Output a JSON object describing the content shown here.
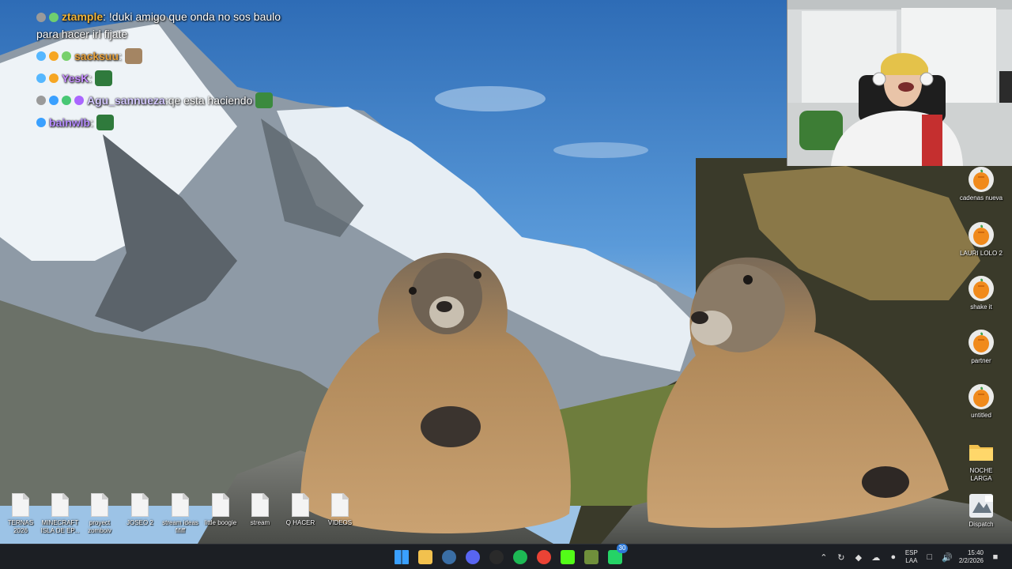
{
  "chat": {
    "messages": [
      {
        "username": "ztample",
        "username_color": "#f2b538",
        "separator": ":",
        "text": " !duki amigo que onda no sos baulo para hacer irl fijate",
        "badges": [
          "#9a9a9a",
          "#6fcf6f"
        ],
        "emotes": []
      },
      {
        "username": "sacksuu",
        "username_color": "#e8a13a",
        "separator": ":",
        "text": "",
        "badges": [
          "#55b7ff",
          "#f6a623",
          "#77d06c"
        ],
        "emotes": [
          "#a48563"
        ]
      },
      {
        "username": "YesK",
        "username_color": "#c58cff",
        "separator": ":",
        "text": "",
        "badges": [
          "#55b7ff",
          "#f6a623"
        ],
        "emotes": [
          "#2f7a3c"
        ]
      },
      {
        "username": "Agu_sannueza",
        "username_color": "#d4c8ff",
        "separator": ":",
        "text": " qe esta haciendo",
        "badges": [
          "#9a9a9a",
          "#3aa0ff",
          "#48c774",
          "#aa66ff"
        ],
        "emotes": [
          "#3b8a3e"
        ]
      },
      {
        "username": "bainwlb",
        "username_color": "#b58cff",
        "separator": ":",
        "text": "",
        "badges": [
          "#3aa0ff"
        ],
        "emotes": [
          "#2f7a3c"
        ]
      }
    ]
  },
  "desktop": {
    "right_icons": [
      {
        "label": "cadenas nueva",
        "icon": "fl-studio-icon"
      },
      {
        "label": "LAURI LOLO 2",
        "icon": "fl-studio-icon"
      },
      {
        "label": "shake it",
        "icon": "fl-studio-icon"
      },
      {
        "label": "partner",
        "icon": "fl-studio-icon"
      },
      {
        "label": "untitled",
        "icon": "fl-studio-icon"
      },
      {
        "label": "NOCHE LARGA",
        "icon": "folder-icon"
      },
      {
        "label": "Dispatch",
        "icon": "game-shortcut-icon"
      }
    ],
    "bottom_icons": [
      {
        "label": "TERNAS 2026",
        "icon": "text-file-icon"
      },
      {
        "label": "MINECRAFT ISLA DE EP...",
        "icon": "text-file-icon"
      },
      {
        "label": "proyect zomboiv",
        "icon": "text-file-icon"
      },
      {
        "label": "JOSEO 2",
        "icon": "text-file-icon"
      },
      {
        "label": "stream ideas fififf",
        "icon": "text-file-icon"
      },
      {
        "label": "little boogie",
        "icon": "text-file-icon"
      },
      {
        "label": "stream",
        "icon": "text-file-icon"
      },
      {
        "label": "Q HACER",
        "icon": "text-file-icon"
      },
      {
        "label": "VIDEOS",
        "icon": "text-file-icon"
      }
    ]
  },
  "taskbar": {
    "apps": [
      {
        "name": "start",
        "icon": "windows-start-icon",
        "color": "#3aa0ff"
      },
      {
        "name": "file-explorer",
        "icon": "folder-icon",
        "color": "#f2c14e"
      },
      {
        "name": "steam",
        "icon": "steam-icon",
        "color": "#3a6ea5"
      },
      {
        "name": "discord",
        "icon": "discord-icon",
        "color": "#5865f2"
      },
      {
        "name": "obs",
        "icon": "obs-icon",
        "color": "#2a2a2a"
      },
      {
        "name": "spotify",
        "icon": "spotify-icon",
        "color": "#1db954"
      },
      {
        "name": "chrome",
        "icon": "chrome-icon",
        "color": "#ea4335"
      },
      {
        "name": "kick",
        "icon": "kick-icon",
        "color": "#53fc18"
      },
      {
        "name": "minecraft",
        "icon": "minecraft-icon",
        "color": "#6f8f3b"
      },
      {
        "name": "whatsapp",
        "icon": "whatsapp-icon",
        "color": "#25d366",
        "badge": "30"
      }
    ],
    "tray": {
      "lang_line1": "ESP",
      "lang_line2": "LAA",
      "time": "15:40",
      "date": "2/2/2026"
    }
  },
  "colors": {
    "taskbar_bg": "#1c1f24",
    "sky": "#4c8fd6"
  }
}
